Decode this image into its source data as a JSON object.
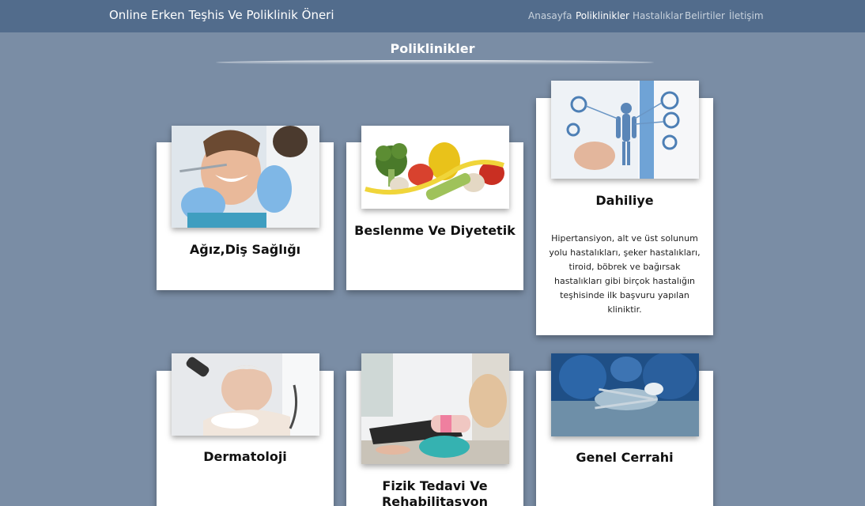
{
  "navbar": {
    "brand": "Online Erken Teşhis Ve Poliklinik Öneri",
    "links": [
      {
        "label": "Anasayfa",
        "active": false
      },
      {
        "label": "Poliklinikler",
        "active": true
      },
      {
        "label": "Hastalıklar",
        "active": false
      },
      {
        "label": "Belirtiler",
        "active": false
      },
      {
        "label": "İletişim",
        "active": false
      }
    ]
  },
  "page": {
    "title": "Poliklinikler"
  },
  "cards": [
    {
      "title": "Ağız,Diş Sağlığı",
      "image_icon": "dentist-photo"
    },
    {
      "title": "Beslenme Ve Diyetetik",
      "image_icon": "vegetables-photo"
    },
    {
      "title": "Dahiliye",
      "image_icon": "internal-medicine-photo",
      "description": "Hipertansiyon, alt ve üst solunum yolu hastalıkları, şeker hastalıkları, tiroid, böbrek ve bağırsak hastalıkları gibi birçok hastalığın teşhisinde ilk başvuru yapılan kliniktir."
    },
    {
      "title": "Dermatoloji",
      "image_icon": "dermatology-photo"
    },
    {
      "title": "Fizik Tedavi Ve Rehabilitasyon",
      "image_icon": "physiotherapy-photo"
    },
    {
      "title": "Genel Cerrahi",
      "image_icon": "surgery-photo"
    }
  ],
  "colors": {
    "background": "#7a8da5",
    "navbar": "#526c8c",
    "card": "#ffffff"
  }
}
